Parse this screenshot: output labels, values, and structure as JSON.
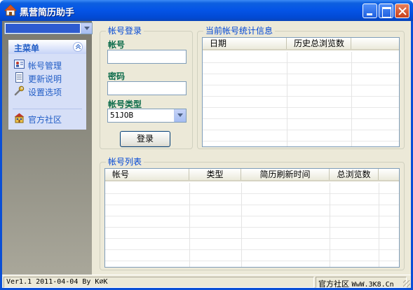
{
  "window": {
    "title": "黑营简历助手"
  },
  "sidebar": {
    "menu_title": "主菜单",
    "items": [
      {
        "label": "帐号管理",
        "icon": "user-card-icon"
      },
      {
        "label": "更新说明",
        "icon": "document-icon"
      },
      {
        "label": "设置选项",
        "icon": "wrench-icon"
      },
      {
        "label": "官方社区",
        "icon": "community-icon"
      }
    ]
  },
  "login": {
    "group_title": "帐号登录",
    "account_label": "帐号",
    "account_value": "",
    "password_label": "密码",
    "password_value": "",
    "type_label": "帐号类型",
    "type_selected": "51JOB",
    "login_button": "登录"
  },
  "stats": {
    "group_title": "当前帐号统计信息",
    "columns": [
      "日期",
      "历史总浏览数"
    ]
  },
  "accounts": {
    "group_title": "帐号列表",
    "columns": [
      "帐号",
      "类型",
      "简历刷新时间",
      "总浏览数"
    ]
  },
  "status": {
    "left": "Ver1.1 2011-04-04 By K∅K",
    "right_label": "官方社区",
    "right_url": "WwW.3K8.Cn"
  }
}
